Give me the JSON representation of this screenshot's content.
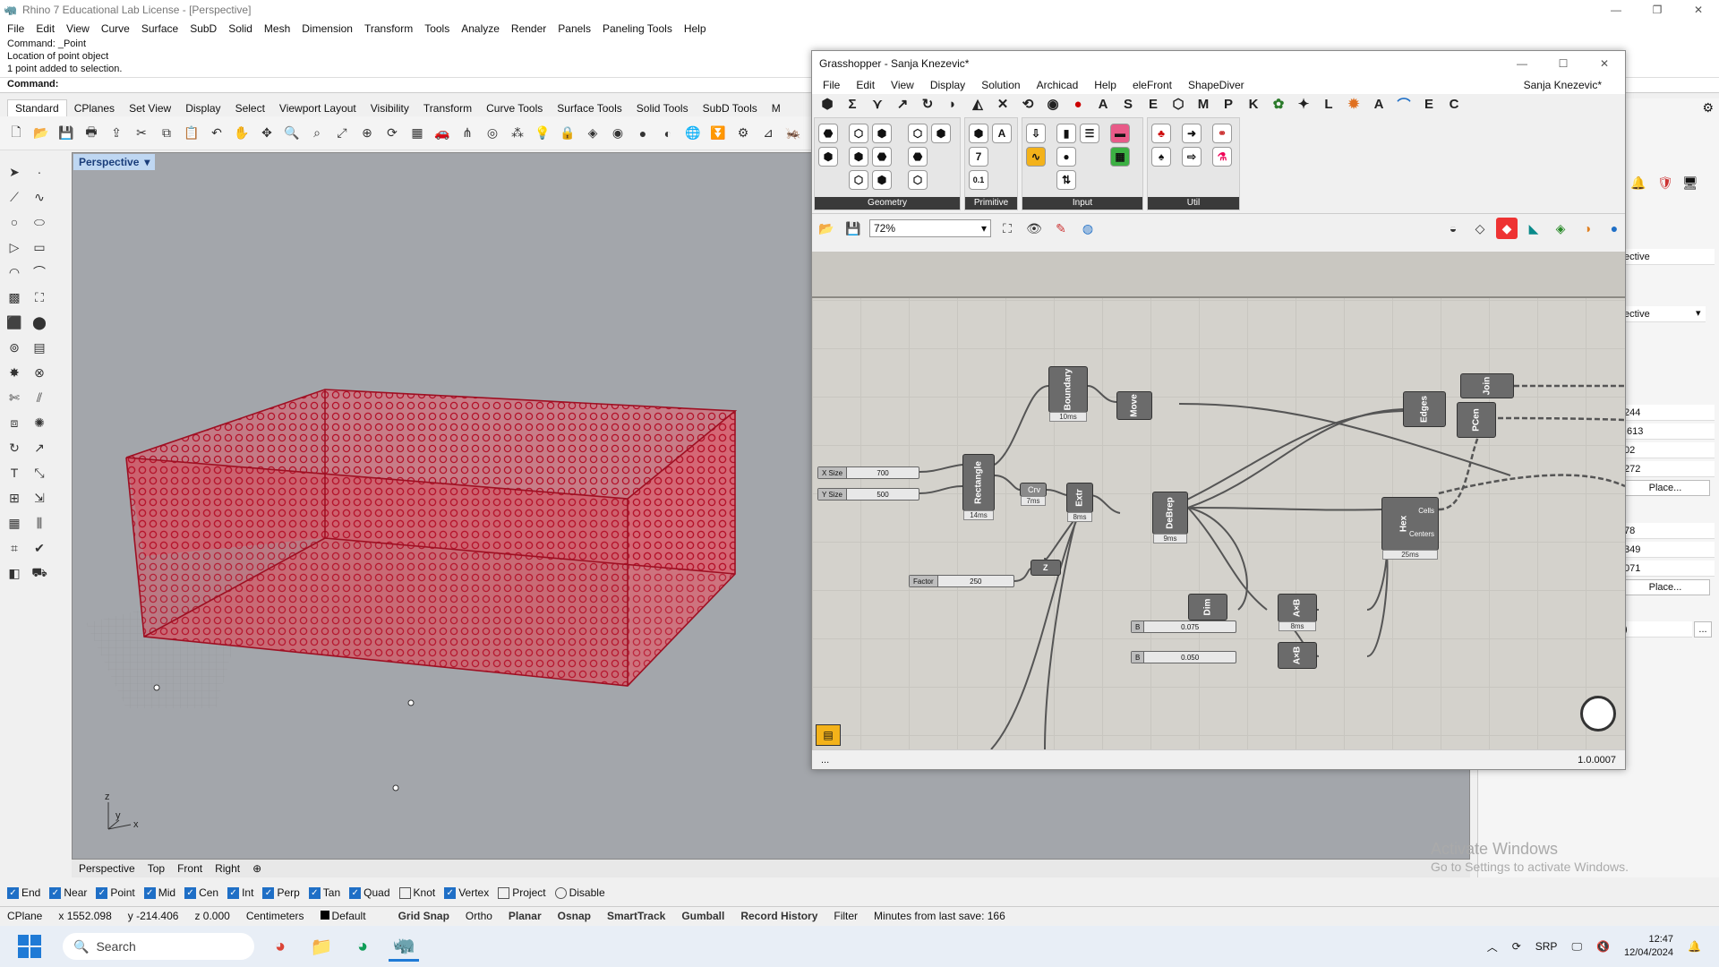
{
  "rhino": {
    "title": "Rhino 7 Educational Lab License - [Perspective]",
    "menu": [
      "File",
      "Edit",
      "View",
      "Curve",
      "Surface",
      "SubD",
      "Solid",
      "Mesh",
      "Dimension",
      "Transform",
      "Tools",
      "Analyze",
      "Render",
      "Panels",
      "Paneling Tools",
      "Help"
    ],
    "command_history": [
      "Command: _Point",
      "Location of point object",
      "1 point added to selection."
    ],
    "command_prompt": "Command:",
    "tool_tabs": [
      "Standard",
      "CPlanes",
      "Set View",
      "Display",
      "Select",
      "Viewport Layout",
      "Visibility",
      "Transform",
      "Curve Tools",
      "Surface Tools",
      "Solid Tools",
      "SubD Tools",
      "M"
    ],
    "viewport_label": "Perspective",
    "viewport_tabs": [
      "Perspective",
      "Top",
      "Front",
      "Right"
    ],
    "axis_labels": {
      "z": "z",
      "y": "y",
      "x": "x"
    },
    "osnaps": [
      {
        "label": "End",
        "on": true
      },
      {
        "label": "Near",
        "on": true
      },
      {
        "label": "Point",
        "on": true
      },
      {
        "label": "Mid",
        "on": true
      },
      {
        "label": "Cen",
        "on": true
      },
      {
        "label": "Int",
        "on": true
      },
      {
        "label": "Perp",
        "on": true
      },
      {
        "label": "Tan",
        "on": true
      },
      {
        "label": "Quad",
        "on": true
      },
      {
        "label": "Knot",
        "on": false
      },
      {
        "label": "Vertex",
        "on": true
      },
      {
        "label": "Project",
        "on": false
      },
      {
        "label": "Disable",
        "on": false
      }
    ],
    "status": {
      "cplane": "CPlane",
      "x": "x 1552.098",
      "y": "y -214.406",
      "z": "z 0.000",
      "units": "Centimeters",
      "layer": "Default",
      "toggles": [
        "Grid Snap",
        "Ortho",
        "Planar",
        "Osnap",
        "SmartTrack",
        "Gumball",
        "Record History",
        "Filter"
      ],
      "last_save": "Minutes from last save: 166"
    },
    "props": {
      "rows": [
        "ective",
        "ective",
        "244",
        ".613",
        "02",
        "272",
        "78",
        "349",
        "071",
        ")"
      ],
      "place_button": "Place...",
      "more": "..."
    }
  },
  "watermark": {
    "line1": "Activate Windows",
    "line2": "Go to Settings to activate Windows."
  },
  "taskbar": {
    "search": "Search",
    "lang": "SRP",
    "time": "12:47",
    "date": "12/04/2024"
  },
  "gh": {
    "title": "Grasshopper - Sanja Knezevic*",
    "menu": [
      "File",
      "Edit",
      "View",
      "Display",
      "Solution",
      "Archicad",
      "Help",
      "eleFront",
      "ShapeDiver"
    ],
    "user": "Sanja Knezevic*",
    "tabs": [
      "Σ",
      "A",
      "S",
      "E",
      "M",
      "P",
      "K",
      "L",
      "A",
      "E",
      "C"
    ],
    "ribbon_groups": [
      "Geometry",
      "Primitive",
      "Input",
      "Util"
    ],
    "primitive_labels": {
      "seven": "7",
      "num": "0.1"
    },
    "zoom": "72%",
    "version": "1.0.0007",
    "status_left": "...",
    "nodes": {
      "boundary": "Boundary",
      "boundary_t": "10ms",
      "move": "Move",
      "rectangle": "Rectangle",
      "rectangle_t": "14ms",
      "crv": "Crv",
      "crv_t": "7ms",
      "extr": "Extr",
      "extr_t": "8ms",
      "debrep": "DeBrep",
      "debrep_t": "9ms",
      "edges": "Edges",
      "join": "Join",
      "pcen": "PCen",
      "hex": "Hex",
      "hex_t": "25ms",
      "hex_out1": "Cells",
      "hex_out2": "Centers",
      "dim": "Dim",
      "axb1": "A×B",
      "axb1_t": "8ms",
      "axb2": "A×B",
      "z": "Z"
    },
    "sliders": [
      {
        "label": "X Size",
        "value": "700"
      },
      {
        "label": "Y Size",
        "value": "500"
      },
      {
        "label": "Factor",
        "value": "250"
      },
      {
        "label": "B",
        "value": "0.075"
      },
      {
        "label": "B",
        "value": "0.050"
      }
    ]
  }
}
